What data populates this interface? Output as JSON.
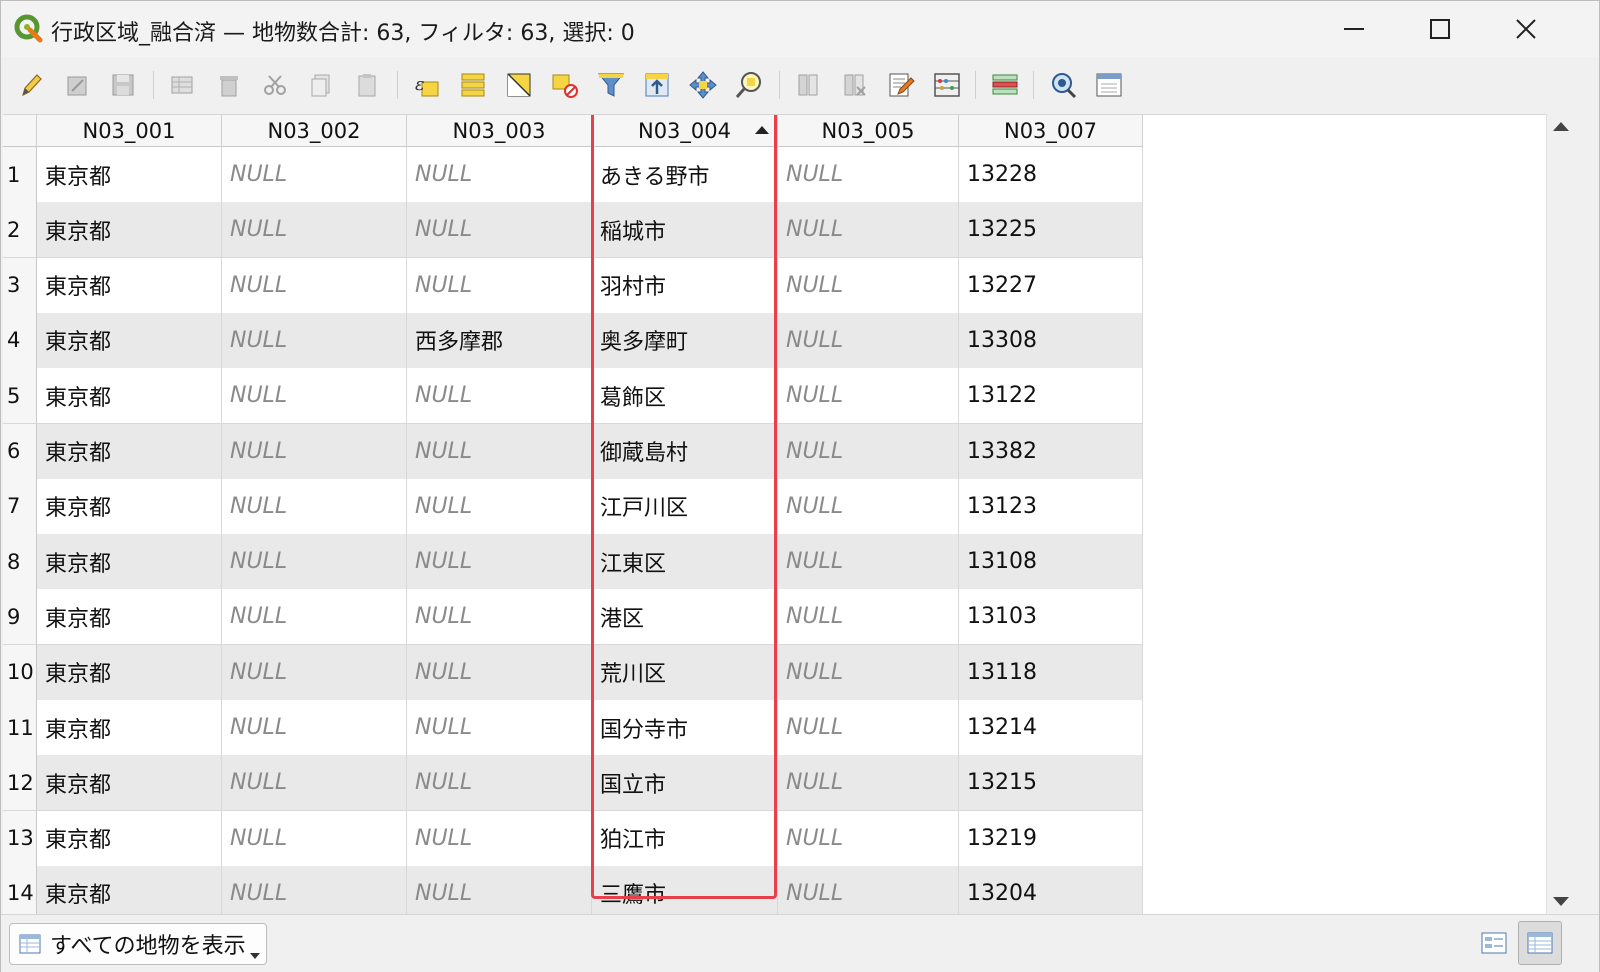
{
  "window": {
    "title": "行政区域_融合済 — 地物数合計: 63, フィルタ: 63, 選択: 0"
  },
  "toolbar": {
    "buttons": [
      "pencil-icon",
      "multi-edit-icon",
      "save-icon",
      "add-feature-icon",
      "delete-icon",
      "cut-icon",
      "copy-icon",
      "paste-icon",
      "select-by-expression-icon",
      "select-all-icon",
      "invert-selection-icon",
      "deselect-icon",
      "filter-icon",
      "move-selection-top-icon",
      "pan-to-selection-icon",
      "zoom-to-selection-icon",
      "new-field-icon",
      "delete-field-icon",
      "field-calculator-icon",
      "conditional-formatting-icon",
      "organize-columns-icon",
      "actions-icon",
      "dock-icon"
    ]
  },
  "table": {
    "columns": [
      "N03_001",
      "N03_002",
      "N03_003",
      "N03_004",
      "N03_005",
      "N03_007"
    ],
    "sorted_column": "N03_004",
    "sort_direction": "ascending",
    "rows": [
      {
        "num": "1",
        "cells": [
          "東京都",
          "NULL",
          "NULL",
          "あきる野市",
          "NULL",
          "13228"
        ]
      },
      {
        "num": "2",
        "cells": [
          "東京都",
          "NULL",
          "NULL",
          "稲城市",
          "NULL",
          "13225"
        ]
      },
      {
        "num": "3",
        "cells": [
          "東京都",
          "NULL",
          "NULL",
          "羽村市",
          "NULL",
          "13227"
        ]
      },
      {
        "num": "4",
        "cells": [
          "東京都",
          "NULL",
          "西多摩郡",
          "奥多摩町",
          "NULL",
          "13308"
        ]
      },
      {
        "num": "5",
        "cells": [
          "東京都",
          "NULL",
          "NULL",
          "葛飾区",
          "NULL",
          "13122"
        ]
      },
      {
        "num": "6",
        "cells": [
          "東京都",
          "NULL",
          "NULL",
          "御蔵島村",
          "NULL",
          "13382"
        ]
      },
      {
        "num": "7",
        "cells": [
          "東京都",
          "NULL",
          "NULL",
          "江戸川区",
          "NULL",
          "13123"
        ]
      },
      {
        "num": "8",
        "cells": [
          "東京都",
          "NULL",
          "NULL",
          "江東区",
          "NULL",
          "13108"
        ]
      },
      {
        "num": "9",
        "cells": [
          "東京都",
          "NULL",
          "NULL",
          "港区",
          "NULL",
          "13103"
        ]
      },
      {
        "num": "10",
        "cells": [
          "東京都",
          "NULL",
          "NULL",
          "荒川区",
          "NULL",
          "13118"
        ]
      },
      {
        "num": "11",
        "cells": [
          "東京都",
          "NULL",
          "NULL",
          "国分寺市",
          "NULL",
          "13214"
        ]
      },
      {
        "num": "12",
        "cells": [
          "東京都",
          "NULL",
          "NULL",
          "国立市",
          "NULL",
          "13215"
        ]
      },
      {
        "num": "13",
        "cells": [
          "東京都",
          "NULL",
          "NULL",
          "狛江市",
          "NULL",
          "13219"
        ]
      },
      {
        "num": "14",
        "cells": [
          "東京都",
          "NULL",
          "NULL",
          "三鷹市",
          "NULL",
          "13204"
        ]
      }
    ]
  },
  "bottom": {
    "filter_label": "すべての地物を表示"
  },
  "colors": {
    "highlight": "#e8404a",
    "null_text": "#8a8a8a",
    "alt_row": "#e9e9e9"
  }
}
